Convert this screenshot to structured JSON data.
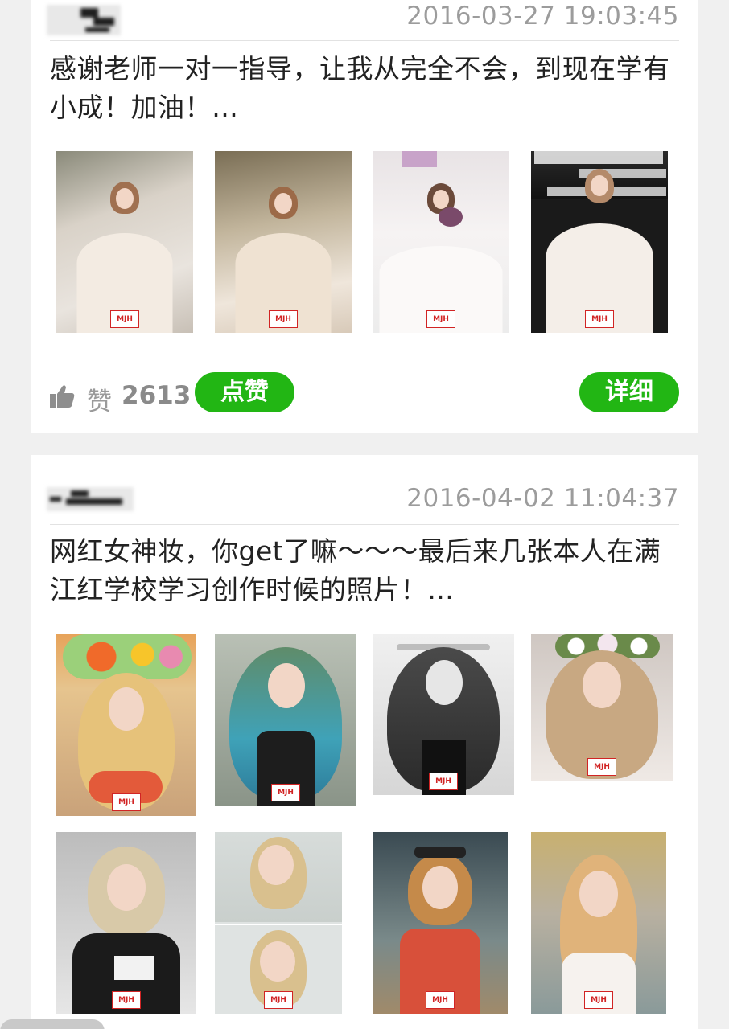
{
  "posts": [
    {
      "timestamp": "2016-03-27 19:03:45",
      "text": "感谢老师一对一指导，让我从完全不会，到现在学有小成！加油！…",
      "likes_label": "赞",
      "likes_count": "2613",
      "like_button": "点赞",
      "detail_button": "详细",
      "photo_watermark": "MJH"
    },
    {
      "timestamp": "2016-04-02 11:04:37",
      "text": "网红女神妆，你get了嘛～～～最后来几张本人在满江红学校学习创作时候的照片！…",
      "photo_watermark": "MJH"
    }
  ],
  "icons": {
    "like": "thumbs-up-icon"
  },
  "colors": {
    "accent_green": "#22b614",
    "timestamp_gray": "#9c9c9c"
  }
}
